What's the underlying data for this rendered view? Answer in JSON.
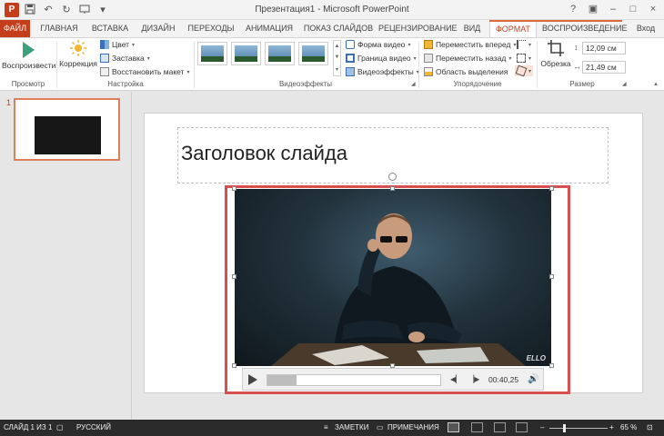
{
  "window": {
    "title": "Презентация1 - Microsoft PowerPoint",
    "app_icon_letter": "P",
    "minimize": "–",
    "restore": "□",
    "close": "×"
  },
  "tabs": {
    "file": "ФАЙЛ",
    "home": "ГЛАВНАЯ",
    "insert": "ВСТАВКА",
    "design": "ДИЗАЙН",
    "transitions": "ПЕРЕХОДЫ",
    "animations": "АНИМАЦИЯ",
    "slideshow": "ПОКАЗ СЛАЙДОВ",
    "review": "РЕЦЕНЗИРОВАНИЕ",
    "view": "ВИД",
    "format": "ФОРМАТ",
    "playback": "ВОСПРОИЗВЕДЕНИЕ",
    "signin": "Вход"
  },
  "ribbon": {
    "preview": {
      "play_label": "Воспроизвести",
      "group": "Просмотр"
    },
    "adjust": {
      "correction": "Коррекция",
      "color": "Цвет",
      "poster": "Заставка",
      "reset": "Восстановить макет",
      "group": "Настройка"
    },
    "styles": {
      "shape": "Форма видео",
      "border": "Граница видео",
      "effects": "Видеоэффекты",
      "group": "Видеоэффекты"
    },
    "arrange": {
      "forward": "Переместить вперед",
      "backward": "Переместить назад",
      "selection": "Область выделения",
      "group": "Упорядочение"
    },
    "size": {
      "crop": "Обрезка",
      "height": "12,09 см",
      "width": "21,49 см",
      "group": "Размер"
    }
  },
  "slides_panel": {
    "slide_number": "1"
  },
  "slide": {
    "title": "Заголовок слайда",
    "video_watermark": "ELLO"
  },
  "player": {
    "time": "00:40,25",
    "progress": 0.17
  },
  "status": {
    "slide_info": "СЛАЙД 1 ИЗ 1",
    "language": "РУССКИЙ",
    "notes": "ЗАМЕТКИ",
    "comments": "ПРИМЕЧАНИЯ",
    "zoom": "65 %"
  },
  "colors": {
    "accent": "#c43e1c",
    "selection_frame": "#d94e4e",
    "statusbar": "#2b2b2b"
  }
}
